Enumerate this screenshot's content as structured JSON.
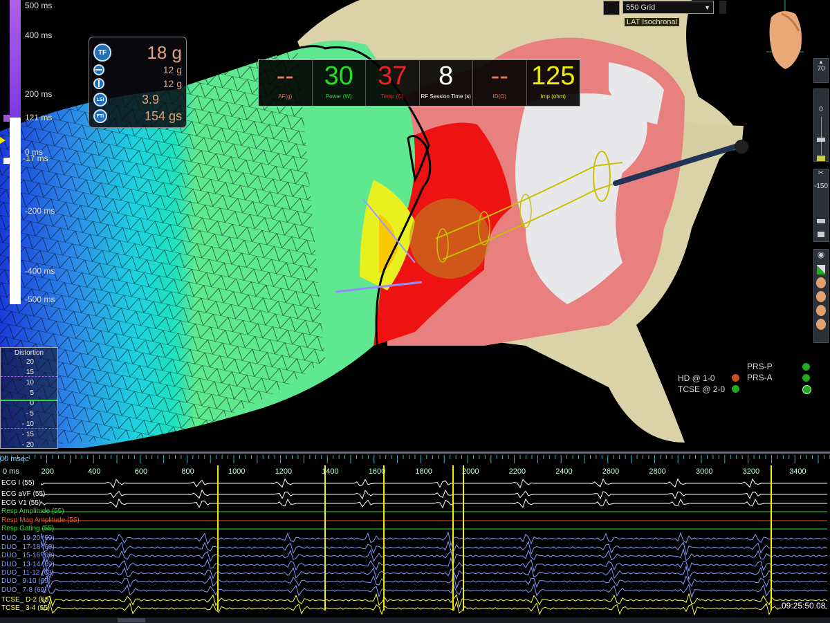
{
  "scale": {
    "labels": [
      "500 ms",
      "400 ms",
      "200 ms",
      "121 ms",
      "0 ms",
      "-17 ms",
      "-200 ms",
      "-400 ms",
      "-500 ms"
    ]
  },
  "force_panel": {
    "tf_badge": "TF",
    "total_force": "18 g",
    "axial_force": "12 g",
    "lateral_force": "12 g",
    "lsi_badge": "LSI",
    "lsi": "3.9",
    "fti_badge": "FTI",
    "fti": "154 gs"
  },
  "rf_panel": [
    {
      "value": "--",
      "label": "AF(g)",
      "color": "#e07a5a"
    },
    {
      "value": "30",
      "label": "Power (W)",
      "color": "#22e022"
    },
    {
      "value": "37",
      "label": "Temp (C)",
      "color": "#ee2020"
    },
    {
      "value": "8",
      "label": "RF Session Time (s)",
      "color": "#ffffff"
    },
    {
      "value": "--",
      "label": "ID(Ω)",
      "color": "#e07a5a"
    },
    {
      "value": "125",
      "label": "Imp (ohm)",
      "color": "#f0f000"
    }
  ],
  "distortion": {
    "title": "Distortion",
    "ticks": [
      "20",
      "15",
      "10",
      "5",
      "0",
      "- 5",
      "- 10",
      "- 15",
      "- 20"
    ]
  },
  "toolbar": {
    "grid_select": "550 Grid",
    "map_label": "LAT Isochronal",
    "zoom": "70",
    "rot1": "0",
    "rot2": "-150"
  },
  "legend": {
    "prs_p": "PRS-P",
    "hd": "HD @ 1-0",
    "prs_a": "PRS-A",
    "tcse": "TCSE @ 2-0"
  },
  "egm": {
    "ruler_top": "00 msec",
    "ticks": [
      "0 ms",
      "200",
      "400",
      "600",
      "800",
      "1000",
      "1200",
      "1400",
      "1600",
      "1800",
      "2000",
      "2200",
      "2400",
      "2600",
      "2800",
      "3000",
      "3200",
      "3400"
    ],
    "channels": [
      {
        "name": "ECG I (55)",
        "color": "#ffffff"
      },
      {
        "name": "ECG aVF (55)",
        "color": "#ffffff"
      },
      {
        "name": "ECG V1 (55)",
        "color": "#ffffff"
      },
      {
        "name": "Resp Amplitude (55)",
        "color": "#33dd33"
      },
      {
        "name": "Resp Mag Amplitude (55)",
        "color": "#ee5533"
      },
      {
        "name": "Resp Gating (55)",
        "color": "#33dd33"
      },
      {
        "name": "DUO_ 19-20 (69)",
        "color": "#8899ff"
      },
      {
        "name": "DUO_ 17-18 (69)",
        "color": "#8899ff"
      },
      {
        "name": "DUO_ 15-16 (69)",
        "color": "#8899ff"
      },
      {
        "name": "DUO_ 13-14 (69)",
        "color": "#8899ff"
      },
      {
        "name": "DUO_ 11-12 (69)",
        "color": "#8899ff"
      },
      {
        "name": "DUO_ 9-10 (69)",
        "color": "#8899ff"
      },
      {
        "name": "DUO_ 7-8 (69)",
        "color": "#8899ff"
      },
      {
        "name": "TCSE_ D-2 (55)",
        "color": "#ffff44"
      },
      {
        "name": "TCSE_ 3-4 (55)",
        "color": "#ffff44"
      }
    ],
    "timestamp": "09:25:50.08"
  }
}
